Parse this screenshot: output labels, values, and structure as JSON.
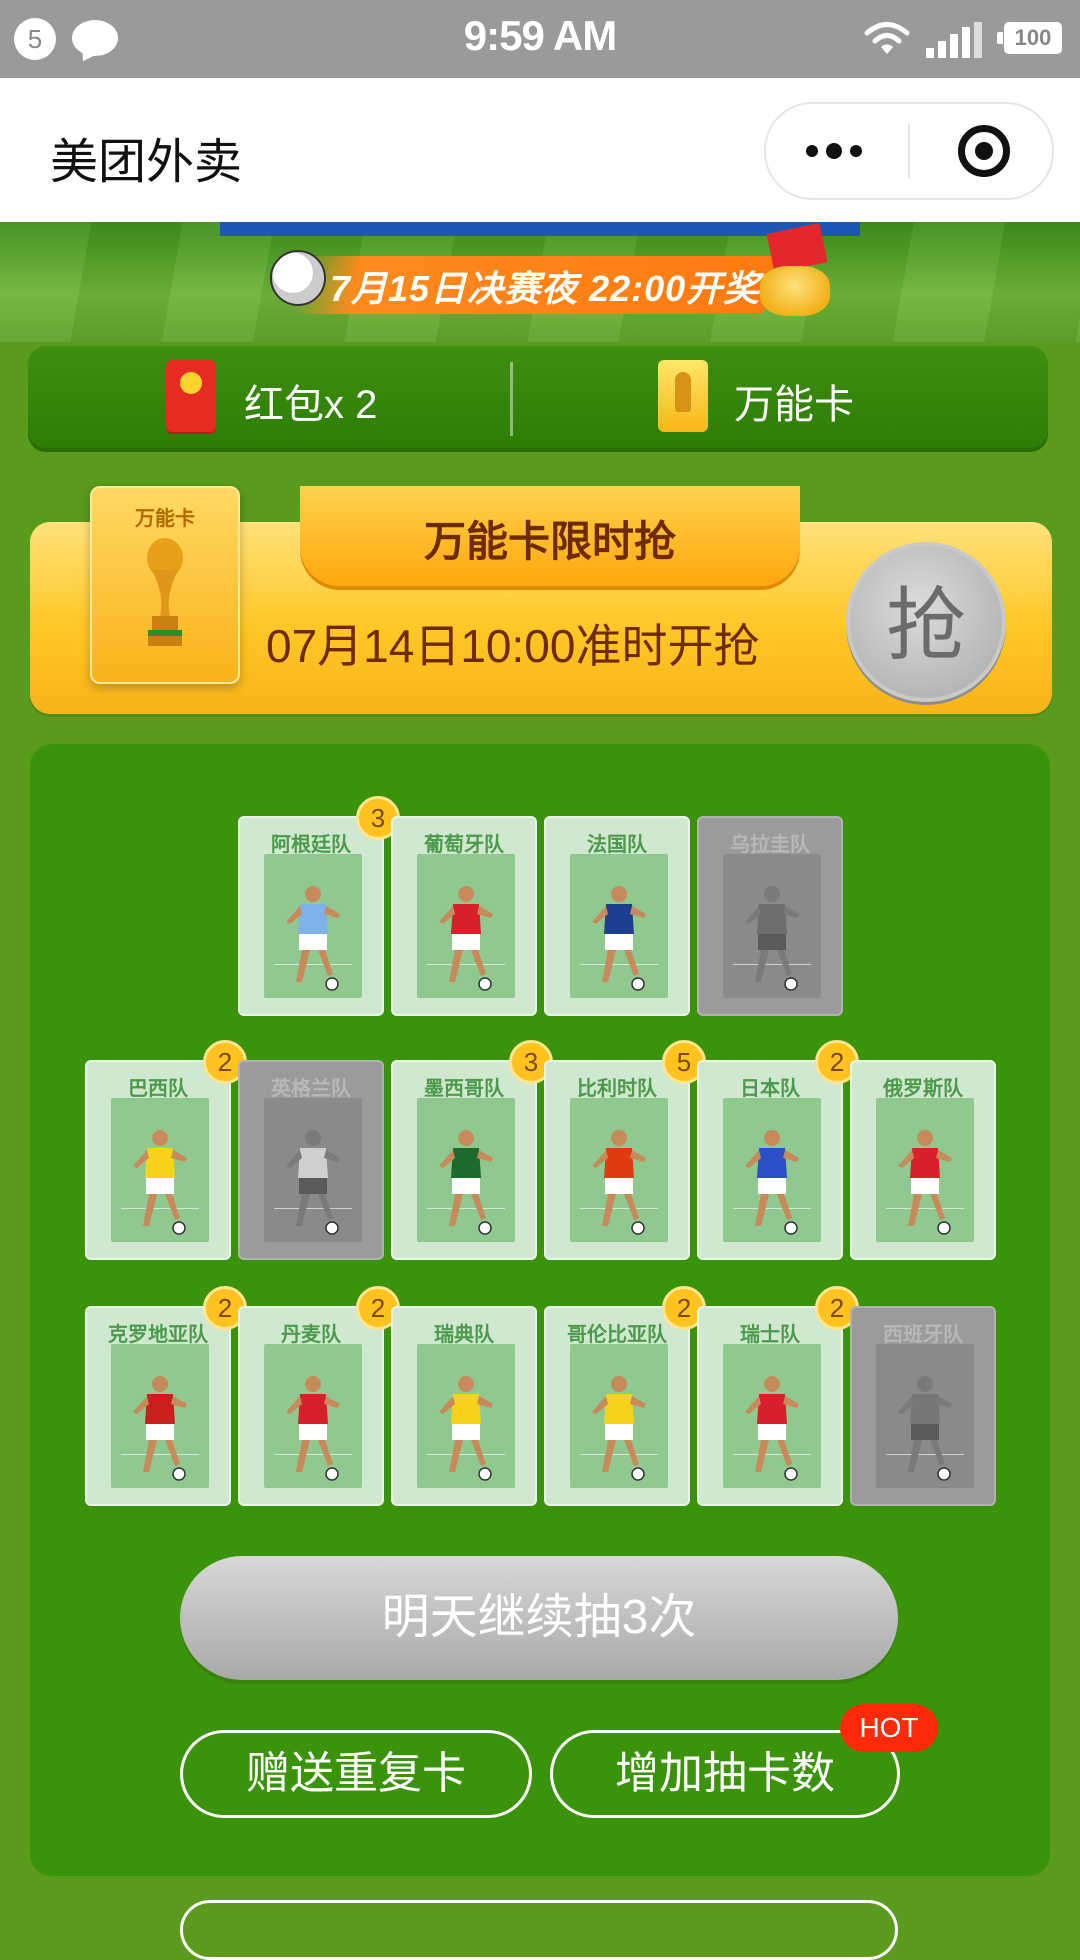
{
  "status_bar": {
    "notification_count": "5",
    "time": "9:59 AM",
    "battery": "100"
  },
  "title_bar": {
    "title": "美团外卖",
    "more_icon": "more-icon",
    "close_icon": "close-circle-icon"
  },
  "banner": {
    "text": "7月15日决赛夜 22:00开奖"
  },
  "rewards": {
    "red_packet_label": "红包x 2",
    "wild_card_label": "万能卡"
  },
  "flash_sale": {
    "card_label": "万能卡",
    "title": "万能卡限时抢",
    "time_text": "07月14日10:00准时开抢",
    "grab_button": "抢"
  },
  "teams": {
    "row1": [
      {
        "name": "阿根廷队",
        "count": "3",
        "locked": false,
        "shirt": "#7fb2e8"
      },
      {
        "name": "葡萄牙队",
        "count": "",
        "locked": false,
        "shirt": "#d8202a"
      },
      {
        "name": "法国队",
        "count": "",
        "locked": false,
        "shirt": "#1e3f8f"
      },
      {
        "name": "乌拉圭队",
        "count": "",
        "locked": true,
        "shirt": "#6e6e6e"
      }
    ],
    "row2": [
      {
        "name": "巴西队",
        "count": "2",
        "locked": false,
        "shirt": "#f7d21a"
      },
      {
        "name": "英格兰队",
        "count": "",
        "locked": true,
        "shirt": "#cfcfcf"
      },
      {
        "name": "墨西哥队",
        "count": "3",
        "locked": false,
        "shirt": "#1e6b2e"
      },
      {
        "name": "比利时队",
        "count": "5",
        "locked": false,
        "shirt": "#e03a12"
      },
      {
        "name": "日本队",
        "count": "2",
        "locked": false,
        "shirt": "#2b4fc4"
      },
      {
        "name": "俄罗斯队",
        "count": "",
        "locked": false,
        "shirt": "#d8202a"
      }
    ],
    "row3": [
      {
        "name": "克罗地亚队",
        "count": "2",
        "locked": false,
        "shirt": "#c8201e"
      },
      {
        "name": "丹麦队",
        "count": "2",
        "locked": false,
        "shirt": "#d8202a"
      },
      {
        "name": "瑞典队",
        "count": "",
        "locked": false,
        "shirt": "#f7d21a"
      },
      {
        "name": "哥伦比亚队",
        "count": "2",
        "locked": false,
        "shirt": "#f7d21a"
      },
      {
        "name": "瑞士队",
        "count": "2",
        "locked": false,
        "shirt": "#d8202a"
      },
      {
        "name": "西班牙队",
        "count": "",
        "locked": true,
        "shirt": "#777777"
      }
    ]
  },
  "actions": {
    "draw_button": "明天继续抽3次",
    "gift_duplicate": "赠送重复卡",
    "add_draws": "增加抽卡数",
    "hot_badge": "HOT"
  }
}
